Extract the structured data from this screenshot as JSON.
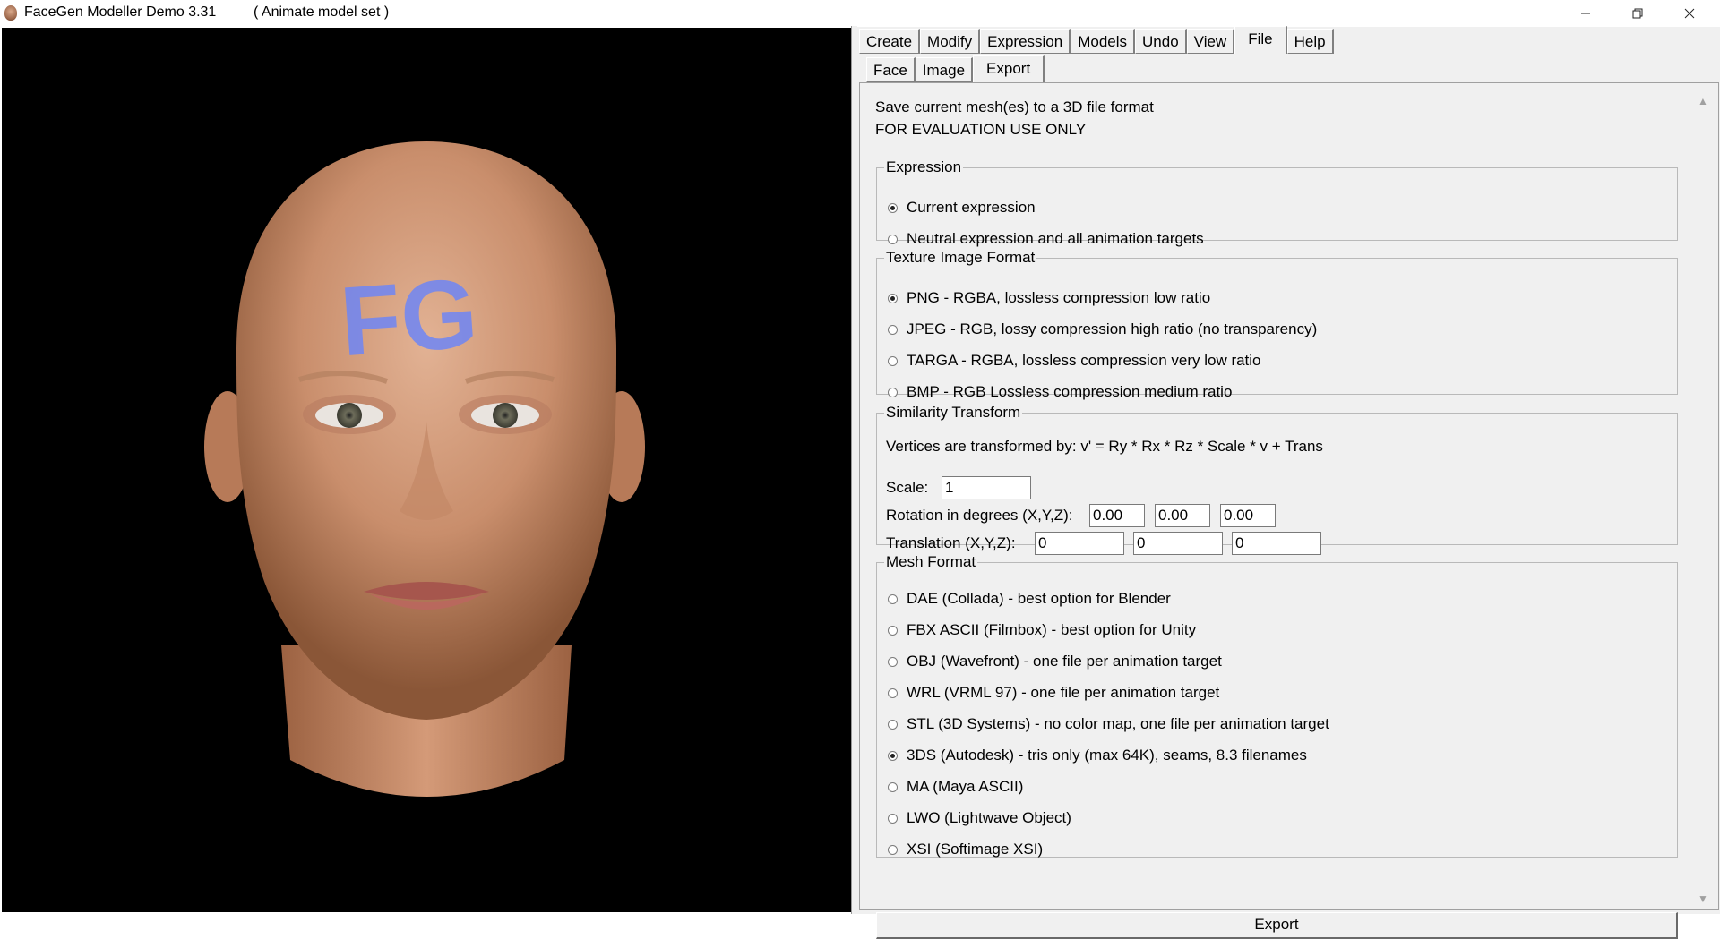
{
  "window": {
    "title": "FaceGen Modeller Demo 3.31",
    "subtitle": "( Animate model set )"
  },
  "top_tabs": [
    {
      "label": "Create"
    },
    {
      "label": "Modify"
    },
    {
      "label": "Expression"
    },
    {
      "label": "Models"
    },
    {
      "label": "Undo"
    },
    {
      "label": "View"
    },
    {
      "label": "File",
      "active": true
    },
    {
      "label": "Help"
    }
  ],
  "sub_tabs": [
    {
      "label": "Face"
    },
    {
      "label": "Image"
    },
    {
      "label": "Export",
      "active": true
    }
  ],
  "intro": {
    "line1": "Save current mesh(es) to a 3D file format",
    "line2": "FOR EVALUATION USE ONLY"
  },
  "expression": {
    "legend": "Expression",
    "options": [
      {
        "label": "Current expression",
        "checked": true
      },
      {
        "label": "Neutral expression and all animation targets",
        "checked": false
      }
    ]
  },
  "texture": {
    "legend": "Texture Image Format",
    "options": [
      {
        "label": "PNG - RGBA, lossless compression low ratio",
        "checked": true
      },
      {
        "label": "JPEG - RGB, lossy compression high ratio (no transparency)",
        "checked": false
      },
      {
        "label": "TARGA - RGBA, lossless compression very low ratio",
        "checked": false
      },
      {
        "label": "BMP - RGB Lossless compression medium ratio",
        "checked": false
      }
    ]
  },
  "similarity": {
    "legend": "Similarity Transform",
    "formula": "Vertices are transformed by: v' = Ry * Rx * Rz * Scale * v + Trans",
    "scale_label": "Scale:",
    "scale_value": "1",
    "rotation_label": "Rotation in degrees (X,Y,Z):",
    "rotation_values": [
      "0.00",
      "0.00",
      "0.00"
    ],
    "translation_label": "Translation (X,Y,Z):",
    "translation_values": [
      "0",
      "0",
      "0"
    ]
  },
  "mesh": {
    "legend": "Mesh Format",
    "options": [
      {
        "label": "DAE (Collada) - best option for Blender",
        "checked": false
      },
      {
        "label": "FBX ASCII (Filmbox) - best option for Unity",
        "checked": false
      },
      {
        "label": "OBJ (Wavefront) - one file per animation target",
        "checked": false
      },
      {
        "label": "WRL (VRML 97) - one file per animation target",
        "checked": false
      },
      {
        "label": "STL (3D Systems) - no color map, one file per animation target",
        "checked": false
      },
      {
        "label": "3DS (Autodesk) - tris only (max 64K), seams, 8.3 filenames",
        "checked": true
      },
      {
        "label": "MA (Maya ASCII)",
        "checked": false
      },
      {
        "label": "LWO (Lightwave Object)",
        "checked": false
      },
      {
        "label": "XSI (Softimage XSI)",
        "checked": false
      }
    ]
  },
  "export_button": "Export",
  "viewport": {
    "forehead_text": "FG",
    "forehead_text_color": "#6f86f5",
    "background": "#000000"
  }
}
